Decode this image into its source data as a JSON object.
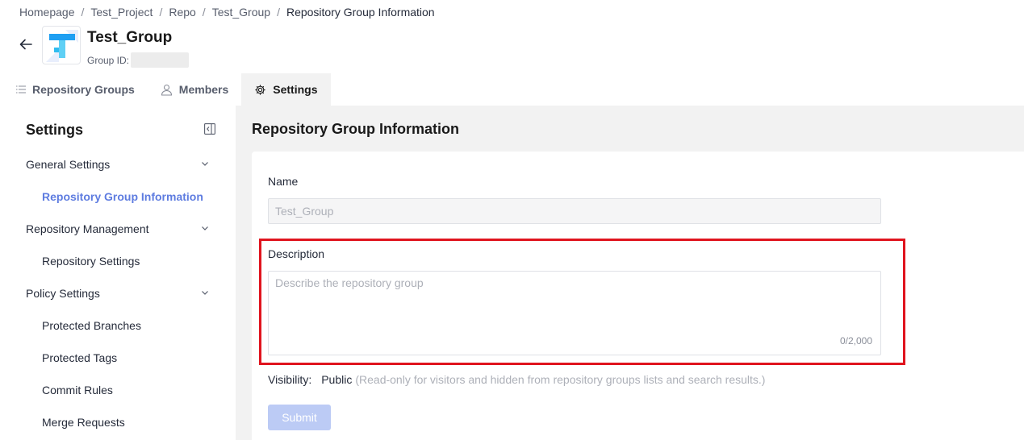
{
  "breadcrumb": {
    "items": [
      "Homepage",
      "Test_Project",
      "Repo",
      "Test_Group"
    ],
    "current": "Repository Group Information",
    "separator": "/"
  },
  "header": {
    "title": "Test_Group",
    "group_id_label": "Group ID:"
  },
  "tabs": [
    {
      "label": "Repository Groups",
      "icon": "list-icon"
    },
    {
      "label": "Members",
      "icon": "user-icon"
    },
    {
      "label": "Settings",
      "icon": "gear-icon",
      "active": true
    }
  ],
  "sidebar": {
    "title": "Settings",
    "groups": [
      {
        "label": "General Settings",
        "items": [
          "Repository Group Information"
        ]
      },
      {
        "label": "Repository Management",
        "items": [
          "Repository Settings"
        ]
      },
      {
        "label": "Policy Settings",
        "items": [
          "Protected Branches",
          "Protected Tags",
          "Commit Rules",
          "Merge Requests"
        ]
      }
    ],
    "selected": "Repository Group Information"
  },
  "main": {
    "title": "Repository Group Information",
    "name_label": "Name",
    "name_value": "Test_Group",
    "description_label": "Description",
    "description_placeholder": "Describe the repository group",
    "description_counter": "0/2,000",
    "visibility_label": "Visibility:",
    "visibility_value": "Public",
    "visibility_hint": "(Read-only for visitors and hidden from repository groups lists and search results.)",
    "submit_label": "Submit"
  },
  "colors": {
    "accent": "#5e7ce0",
    "highlight": "#e0141e",
    "submit_disabled": "#bccbf5",
    "background": "#f2f2f2"
  }
}
